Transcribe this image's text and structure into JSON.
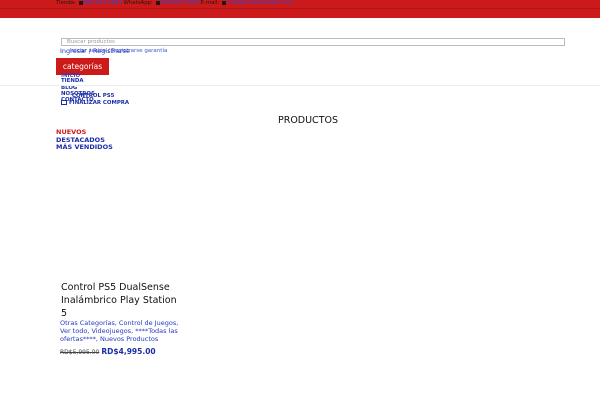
{
  "colors": {
    "brand_red": "#cc1a1a",
    "link_blue": "#1b2ea8"
  },
  "topbar": {
    "tienda_label": "Tienda:",
    "tienda_phone": "809-542-3694",
    "whatsapp_label": "WhatsApp:",
    "whatsapp_phone": "809-696-7046",
    "email_label": "E-mail:",
    "email": "info@portaltoshiprd.com"
  },
  "search": {
    "placeholder": "Buscar productos"
  },
  "account": {
    "login_register": "Ingresar / Registrarse",
    "overlap_text": "Iniciar sesión / Registrarse"
  },
  "overlap_text_small": "garantía",
  "categories_button": "categorías",
  "nav": {
    "inicio": "INICIO",
    "tienda": "TIENDA",
    "blog": "BLOG",
    "nosotros": "NOSOTROS",
    "contacto": "CONTACTO",
    "ps5": "CONTROL PS5",
    "finalizar_compra": "FINALIZAR COMPRA"
  },
  "section": {
    "title": "PRODUCTOS",
    "filters": {
      "nuevos": "NUEVOS",
      "destacados": "DESTACADOS",
      "mas_vendidos": "MÁS VENDIDOS"
    }
  },
  "product": {
    "name": "Control PS5 DualSense Inalámbrico Play Station 5",
    "categories": "Otras Categorías, Control de Juegos, Ver todo, Videojuegos, ****Todas las ofertas****, Nuevos Productos",
    "price_old": "RD$5,995.00",
    "price_new": "RD$4,995.00"
  }
}
